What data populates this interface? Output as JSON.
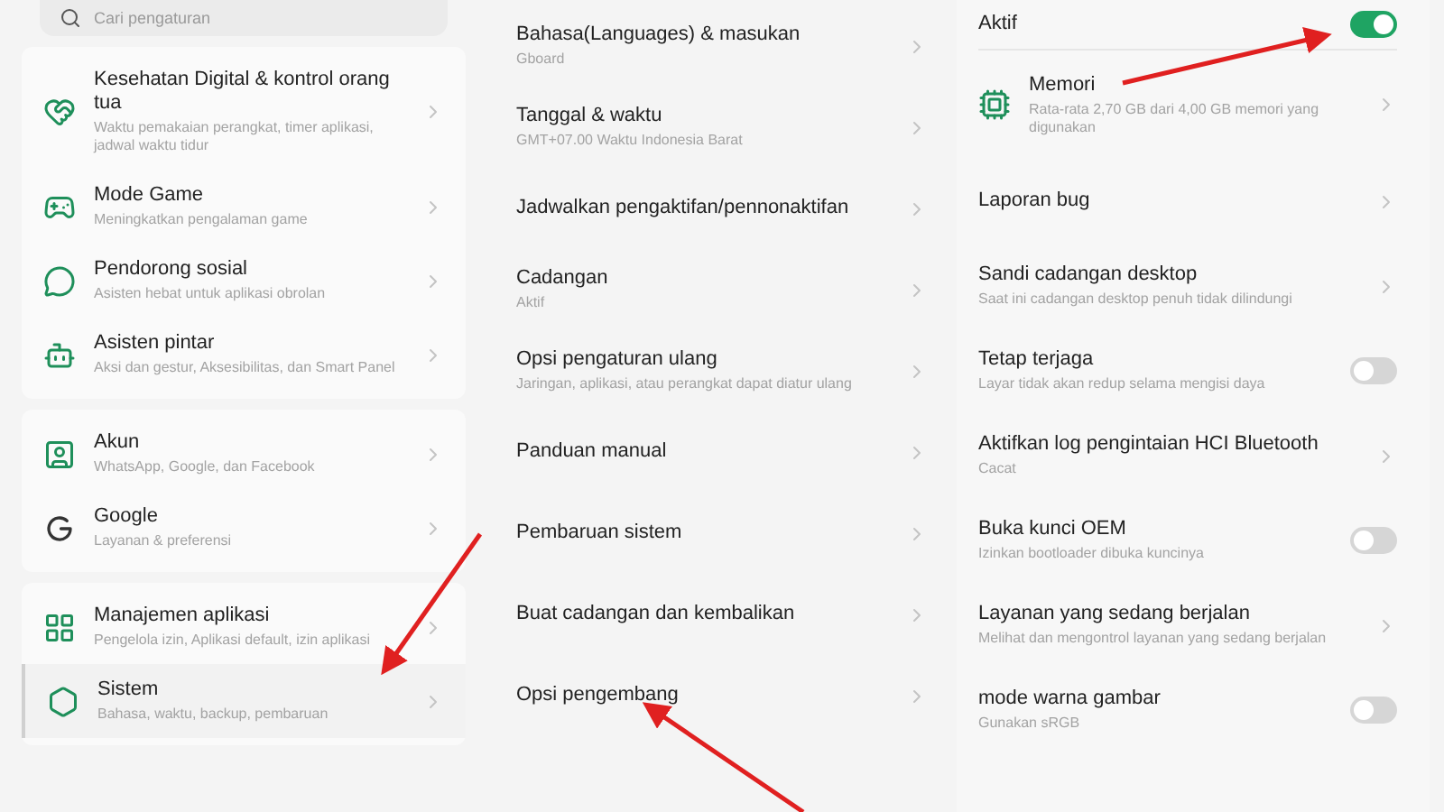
{
  "search": {
    "placeholder": "Cari pengaturan"
  },
  "left_groups": [
    {
      "items": [
        {
          "title": "Kesehatan Digital & kontrol orang tua",
          "subtitle": "Waktu pemakaian perangkat, timer aplikasi, jadwal waktu tidur",
          "selected": false
        },
        {
          "title": "Mode Game",
          "subtitle": "Meningkatkan pengalaman game",
          "selected": false
        },
        {
          "title": "Pendorong sosial",
          "subtitle": "Asisten hebat untuk aplikasi obrolan",
          "selected": false
        },
        {
          "title": "Asisten pintar",
          "subtitle": "Aksi dan gestur, Aksesibilitas, dan Smart Panel",
          "selected": false
        }
      ]
    },
    {
      "items": [
        {
          "title": "Akun",
          "subtitle": "WhatsApp, Google, dan Facebook",
          "selected": false
        },
        {
          "title": "Google",
          "subtitle": "Layanan & preferensi",
          "selected": false
        }
      ]
    },
    {
      "items": [
        {
          "title": "Manajemen aplikasi",
          "subtitle": "Pengelola izin, Aplikasi default, izin aplikasi",
          "selected": false
        },
        {
          "title": "Sistem",
          "subtitle": "Bahasa, waktu, backup, pembaruan",
          "selected": true
        }
      ]
    }
  ],
  "middle_items": [
    {
      "title": "Bahasa(Languages) & masukan",
      "subtitle": "Gboard"
    },
    {
      "title": "Tanggal & waktu",
      "subtitle": "GMT+07.00 Waktu Indonesia Barat"
    },
    {
      "title": "Jadwalkan pengaktifan/pennonaktifan"
    },
    {
      "title": "Cadangan",
      "subtitle": "Aktif"
    },
    {
      "title": "Opsi pengaturan ulang",
      "subtitle": "Jaringan, aplikasi, atau perangkat dapat diatur ulang"
    },
    {
      "title": "Panduan manual"
    },
    {
      "title": "Pembaruan sistem"
    },
    {
      "title": "Buat cadangan dan kembalikan"
    },
    {
      "title": "Opsi pengembang"
    }
  ],
  "right_top": {
    "title": "Aktif",
    "on": true
  },
  "right_items": [
    {
      "kind": "link",
      "title": "Memori",
      "subtitle": "Rata-rata 2,70 GB dari 4,00 GB memori yang digunakan"
    },
    {
      "kind": "link",
      "title": "Laporan bug"
    },
    {
      "kind": "link",
      "title": "Sandi cadangan desktop",
      "subtitle": "Saat ini cadangan desktop penuh tidak dilindungi"
    },
    {
      "kind": "toggle",
      "title": "Tetap terjaga",
      "subtitle": "Layar tidak akan redup selama mengisi daya",
      "on": false
    },
    {
      "kind": "link",
      "title": "Aktifkan log pengintaian HCI Bluetooth",
      "subtitle": "Cacat"
    },
    {
      "kind": "toggle",
      "title": "Buka kunci OEM",
      "subtitle": "Izinkan bootloader dibuka kuncinya",
      "on": false
    },
    {
      "kind": "link",
      "title": "Layanan yang sedang berjalan",
      "subtitle": "Melihat dan mengontrol layanan yang sedang berjalan"
    },
    {
      "kind": "toggle",
      "title": "mode warna gambar",
      "subtitle": "Gunakan sRGB",
      "on": false
    }
  ]
}
